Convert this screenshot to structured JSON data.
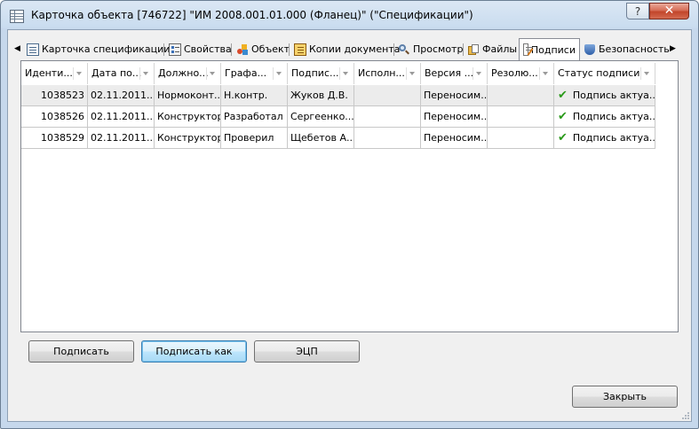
{
  "window": {
    "title": "Карточка объекта [746722] \"ИМ 2008.001.01.000 (Фланец)\" (\"Спецификации\")",
    "help_label": "?",
    "close_label": "✕"
  },
  "tabs": [
    {
      "label": "Карточка спецификации",
      "icon": "spec-card-icon"
    },
    {
      "label": "Свойства",
      "icon": "properties-icon"
    },
    {
      "label": "Объект",
      "icon": "object-icon"
    },
    {
      "label": "Копии документа",
      "icon": "document-copies-icon"
    },
    {
      "label": "Просмотр",
      "icon": "magnifier-icon"
    },
    {
      "label": "Файлы",
      "icon": "files-icon"
    },
    {
      "label": "Подписи",
      "icon": "signatures-icon",
      "active": true
    },
    {
      "label": "Безопасность",
      "icon": "shield-icon"
    }
  ],
  "grid": {
    "columns": [
      "Иденти...",
      "Дата по...",
      "Должно...",
      "Графа...",
      "Подпис...",
      "Исполн...",
      "Версия ...",
      "Резолю...",
      "Статус подписи"
    ],
    "rows": [
      [
        "1038523",
        "02.11.2011...",
        "Нормоконт...",
        "Н.контр.",
        "Жуков Д.В.",
        "",
        "Переносим...",
        "",
        "Подпись актуа..."
      ],
      [
        "1038526",
        "02.11.2011...",
        "Конструктор",
        "Разработал",
        "Сергеенко...",
        "",
        "Переносим...",
        "",
        "Подпись актуа..."
      ],
      [
        "1038529",
        "02.11.2011...",
        "Конструктор",
        "Проверил",
        "Щебетов А....",
        "",
        "Переносим...",
        "",
        "Подпись актуа..."
      ]
    ]
  },
  "buttons": {
    "sign": "Подписать",
    "sign_as": "Подписать как",
    "eds": "ЭЦП",
    "close": "Закрыть"
  },
  "colors": {
    "check": "#2a9a1a",
    "close_button": "#c2452b",
    "focused_button": "#3c7fb1"
  }
}
